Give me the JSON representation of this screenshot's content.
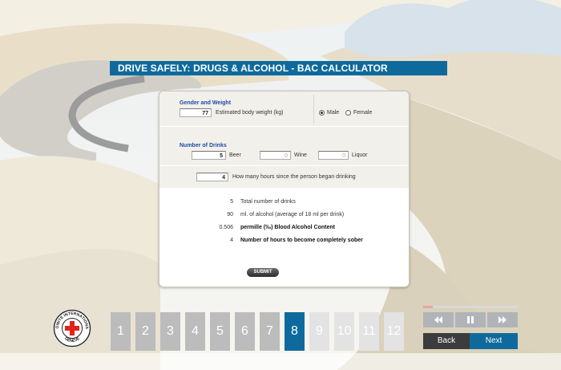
{
  "title": "DRIVE SAFELY: DRUGS & ALCOHOL - BAC CALCULATOR",
  "gender_weight": {
    "header": "Gender and Weight",
    "weight_value": "77",
    "weight_label": "Estimated body weight (kg)",
    "gender_options": [
      {
        "label": "Male",
        "selected": true
      },
      {
        "label": "Female",
        "selected": false
      }
    ]
  },
  "drinks": {
    "header": "Number of Drinks",
    "beer_value": "5",
    "beer_label": "Beer",
    "wine_value": "0",
    "wine_label": "Wine",
    "liquor_value": "0",
    "liquor_label": "Liquor"
  },
  "hours": {
    "value": "4",
    "label": "How many hours since the person began drinking"
  },
  "results": [
    {
      "value": "5",
      "label": "Total number of drinks",
      "bold": false
    },
    {
      "value": "90",
      "label": "ml. of alcohol (average of 18 ml per drink)",
      "bold": false
    },
    {
      "value": "0.506",
      "label": "permille (‰) Blood Alcohol Content",
      "bold": true
    },
    {
      "value": "4",
      "label": "Number of hours to become completely sober",
      "bold": true
    }
  ],
  "submit_label": "SUBMIT",
  "logo": {
    "ring_text": "COMITE INTERNATIONAL",
    "city_text": "GENEVE",
    "icon": "red-cross-icon"
  },
  "pagination": {
    "pages": [
      "1",
      "2",
      "3",
      "4",
      "5",
      "6",
      "7",
      "8",
      "9",
      "10",
      "11",
      "12"
    ],
    "current": "8"
  },
  "media_controls": {
    "progress_fraction": 0.1,
    "rewind_icon": "rewind-icon",
    "pause_icon": "pause-icon",
    "forward_icon": "fast-forward-icon"
  },
  "nav": {
    "back_label": "Back",
    "next_label": "Next"
  },
  "colors": {
    "accent": "#0e6a9c",
    "red_cross": "#e32219"
  }
}
